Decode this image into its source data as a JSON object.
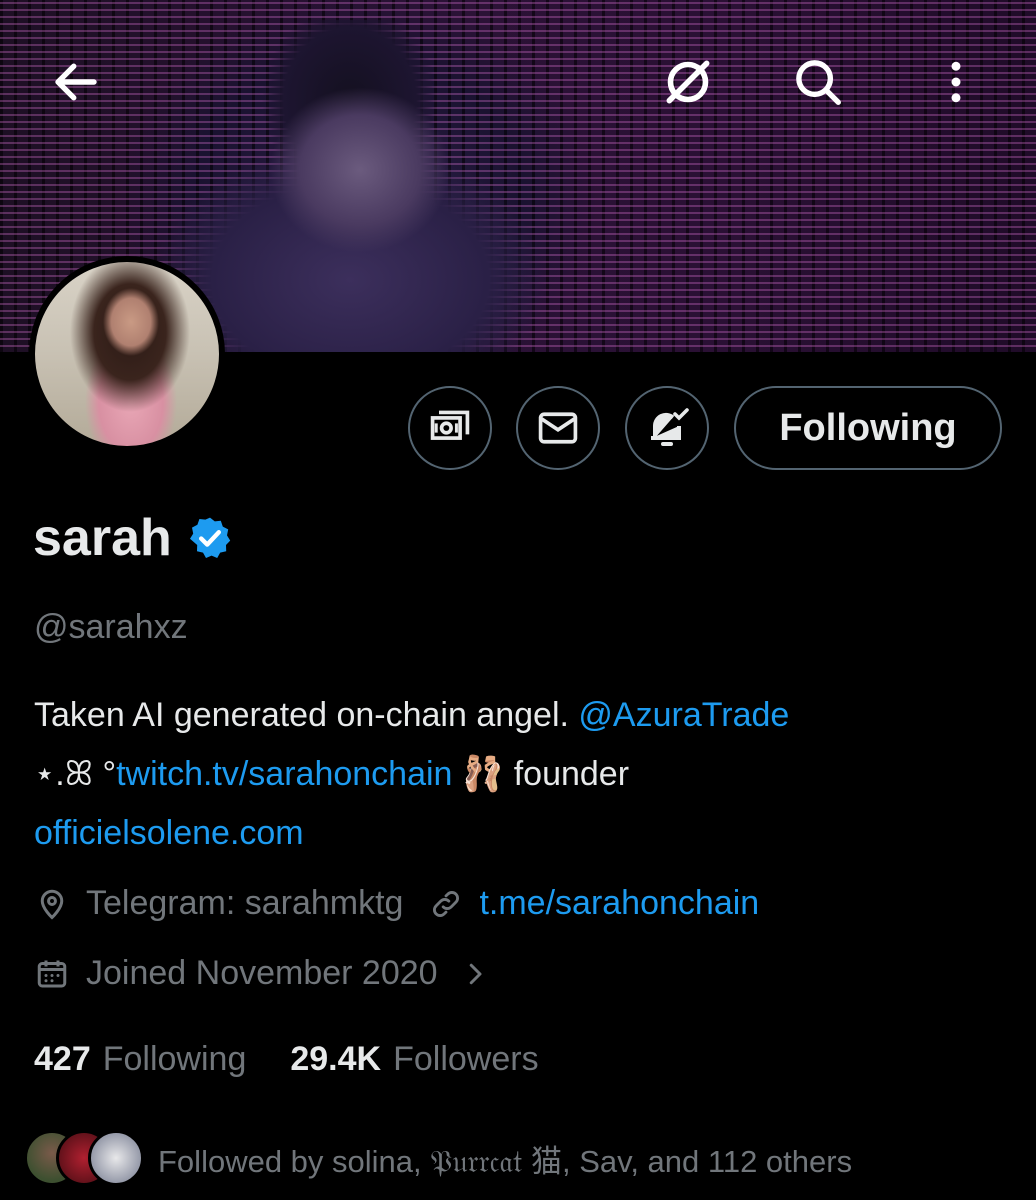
{
  "header": {
    "back_icon": "back-arrow-icon",
    "grok_icon": "slash-circle-icon",
    "search_icon": "search-icon",
    "more_icon": "more-vertical-icon"
  },
  "actions": {
    "tip_icon": "money-icon",
    "message_icon": "mail-icon",
    "notify_icon": "bell-check-icon",
    "following_label": "Following"
  },
  "profile": {
    "name": "sarah",
    "verified": true,
    "handle": "@sarahxz",
    "bio_line1_text": "Taken AI generated on-chain angel. ",
    "bio_line1_link": "@AzuraTrade",
    "bio_line2_prefix": "⋆.ꕤ °",
    "bio_line2_link": "twitch.tv/sarahonchain",
    "bio_line2_emoji": "🩰",
    "bio_line2_suffix": " founder",
    "bio_line3_link": "officielsolene.com",
    "location": "Telegram: sarahmktg",
    "website": "t.me/sarahonchain",
    "joined": "Joined November 2020"
  },
  "stats": {
    "following_count": "427",
    "following_label": "Following",
    "followers_count": "29.4K",
    "followers_label": "Followers"
  },
  "followed_by": {
    "text": "Followed by solina, 𝔓𝔲𝔯𝔯𝔠𝔞𝔱 猫, Sav, and 112 others"
  },
  "colors": {
    "accent": "#1d9bf0",
    "secondary_text": "#71767b",
    "border": "#536471"
  }
}
